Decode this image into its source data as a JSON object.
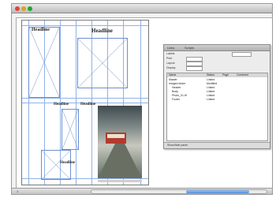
{
  "window": {
    "title": "",
    "traffic_lights": {
      "close": "#e0443e",
      "minimize": "#dea123",
      "zoom": "#1aab29"
    }
  },
  "layout_page": {
    "headlines": {
      "top_left": "Headline",
      "top_right": "Headline",
      "mid_left": "Headline",
      "mid_center": "Headline",
      "bottom": "Headline"
    },
    "guide_color": "#8fb2e6",
    "frame_color": "#6e8fd0"
  },
  "panel": {
    "tabs": [
      "Links",
      "Scripts"
    ],
    "header_fields": [
      "Labels",
      "Print",
      "Layout",
      "Display",
      "Spot Colors"
    ],
    "columns": [
      "Name",
      "",
      "Status",
      "Page",
      "Comment"
    ],
    "rows": [
      {
        "name": "Master",
        "status": "Linked",
        "page": "",
        "comment": ""
      },
      {
        "name": "Images folder",
        "status": "Modified",
        "page": "",
        "comment": ""
      },
      {
        "name": "Header",
        "status": "Linked",
        "page": "",
        "comment": ""
      },
      {
        "name": "Body",
        "status": "Linked",
        "page": "",
        "comment": ""
      },
      {
        "name": "Photo_01.tif",
        "status": "Linked",
        "page": "",
        "comment": ""
      },
      {
        "name": "Footer",
        "status": "Linked",
        "page": "",
        "comment": ""
      }
    ],
    "footer_text": "Show/hide panel"
  },
  "statusbar": {
    "page_indicator": "1"
  }
}
